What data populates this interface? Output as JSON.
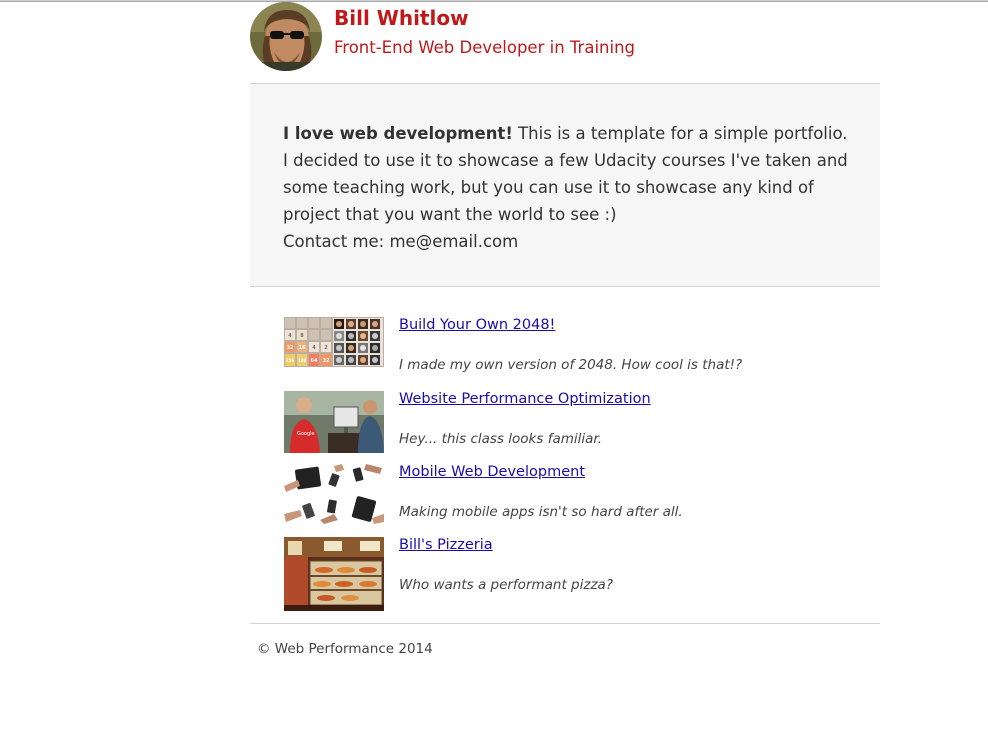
{
  "profile": {
    "name": "Bill Whitlow",
    "tagline": "Front-End Web Developer in Training"
  },
  "about": {
    "lead": "I love web development!",
    "body": " This is a template for a simple portfolio. I decided to use it to showcase a few Udacity courses I've taken and some teaching work, but you can use it to showcase any kind of project that you want the world to see :)",
    "contact": "Contact me: me@email.com"
  },
  "projects": [
    {
      "title": "Build Your Own 2048!",
      "description": "I made my own version of 2048. How cool is that!?",
      "thumb_tiles": [
        "4",
        "8",
        "32",
        "16",
        "4",
        "2",
        "256",
        "128",
        "64",
        "32"
      ]
    },
    {
      "title": "Website Performance Optimization",
      "description": "Hey... this class looks familiar.",
      "thumb_text": "Google"
    },
    {
      "title": "Mobile Web Development",
      "description": "Making mobile apps isn't so hard after all."
    },
    {
      "title": "Bill's Pizzeria",
      "description": "Who wants a performant pizza?"
    }
  ],
  "footer": {
    "text": "© Web Performance 2014"
  },
  "colors": {
    "brand_red": "#c0181b",
    "link": "#1a0dab",
    "about_bg": "#f6f6f6"
  }
}
